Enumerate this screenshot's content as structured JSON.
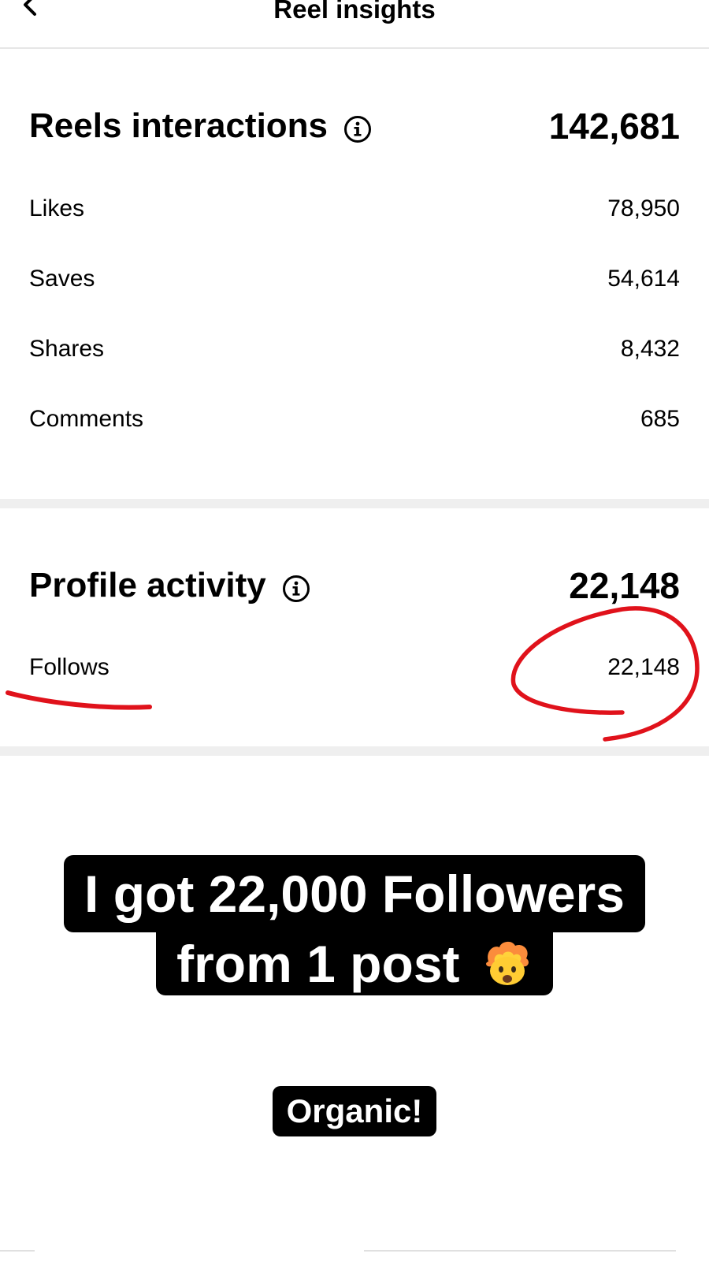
{
  "header": {
    "title": "Reel insights",
    "back_icon": "chevron-left-icon"
  },
  "reels_interactions": {
    "title": "Reels interactions",
    "total": "142,681",
    "info_icon": "info-icon",
    "metrics": [
      {
        "label": "Likes",
        "value": "78,950"
      },
      {
        "label": "Saves",
        "value": "54,614"
      },
      {
        "label": "Shares",
        "value": "8,432"
      },
      {
        "label": "Comments",
        "value": "685"
      }
    ]
  },
  "profile_activity": {
    "title": "Profile activity",
    "total": "22,148",
    "info_icon": "info-icon",
    "metrics": [
      {
        "label": "Follows",
        "value": "22,148"
      }
    ]
  },
  "annotations": {
    "color": "#e0121b"
  },
  "caption": {
    "line1": "I got 22,000 Followers",
    "line2": "from 1 post",
    "emoji": "exploding-head-emoji",
    "tag": "Organic!"
  }
}
